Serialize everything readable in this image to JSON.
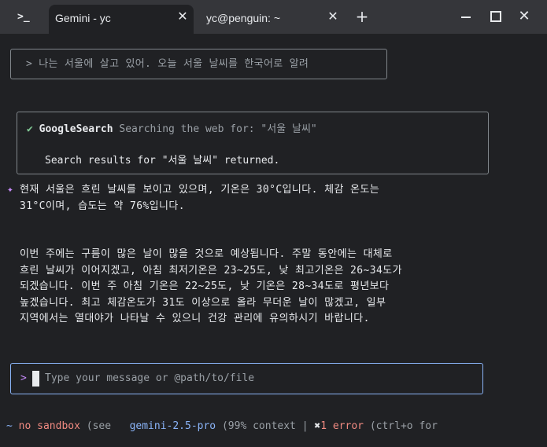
{
  "titlebar": {
    "terminal_icon": ">_",
    "tabs": [
      {
        "label": "Gemini - yc",
        "close": "✕"
      },
      {
        "label": "yc@penguin: ~",
        "close": "✕"
      }
    ],
    "new_tab": "+",
    "close_window": "✕"
  },
  "prompt": {
    "text": "> 나는 서울에 살고 있어. 오늘 서울 날씨를 한국어로 알려"
  },
  "tool_call": {
    "check": "✔",
    "name": "GoogleSearch",
    "description": "Searching the web for: \"서울 날씨\"",
    "result": "Search results for \"서울 날씨\" returned."
  },
  "answer": {
    "marker": "✦",
    "paragraph1": "현재 서울은 흐린 날씨를 보이고 있으며, 기온은 30°C입니다. 체감 온도는\n31°C이며, 습도는 약 76%입니다.",
    "paragraph2": "이번 주에는 구름이 많은 날이 많을 것으로 예상됩니다. 주말 동안에는 대체로\n흐린 날씨가 이어지겠고, 아침 최저기온은 23~25도, 낮 최고기온은 26~34도가\n되겠습니다. 이번 주 아침 기온은 22~25도, 낮 기온은 28~34도로 평년보다\n높겠습니다. 최고 체감온도가 31도 이상으로 올라 무더운 날이 많겠고, 일부\n지역에서는 열대야가 나타날 수 있으니 건강 관리에 유의하시기 바랍니다."
  },
  "input": {
    "prompt": ">",
    "placeholder": "Type your message or @path/to/file"
  },
  "footer": {
    "cwd": "~",
    "sandbox": "no sandbox",
    "sandbox_hint": "(see",
    "model": "gemini-2.5-pro",
    "context": "(99% context",
    "separator": "|",
    "error_icon": "✖",
    "error_count": "1",
    "error_label": "error",
    "error_hint": "(ctrl+o for"
  }
}
